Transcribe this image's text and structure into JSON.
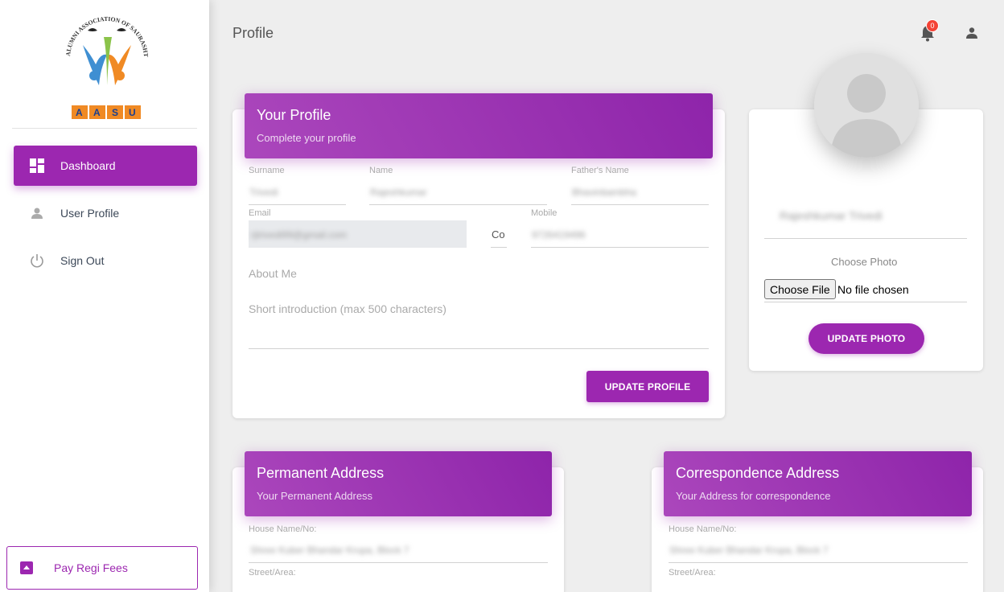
{
  "sidebar": {
    "logo": {
      "arc_text": "ALUMNI ASSOCIATION OF SAURASHTRA UNIVERSITY",
      "letters": [
        "A",
        "A",
        "S",
        "U"
      ]
    },
    "items": [
      {
        "label": "Dashboard",
        "icon": "dashboard-icon",
        "active": true
      },
      {
        "label": "User Profile",
        "icon": "person-icon",
        "active": false
      },
      {
        "label": "Sign Out",
        "icon": "power-icon",
        "active": false
      }
    ],
    "pay_button": {
      "label": "Pay Regi Fees",
      "icon": "unarchive-icon"
    }
  },
  "header": {
    "title": "Profile",
    "notification_count": "0"
  },
  "profile_card": {
    "title": "Your Profile",
    "subtitle": "Complete your profile",
    "fields": {
      "surname": {
        "label": "Surname",
        "value": "Trivedi"
      },
      "name": {
        "label": "Name",
        "value": "Rajeshkumar"
      },
      "father_name": {
        "label": "Father's Name",
        "value": "Bhavinbambha"
      },
      "email": {
        "label": "Email",
        "value": "rjtrivedi99@gmail.com"
      },
      "country_code": {
        "value": "Co"
      },
      "mobile": {
        "label": "Mobile",
        "value": "9726419496"
      },
      "about_me": {
        "label": "About Me",
        "placeholder": "Short introduction (max 500 characters)"
      }
    },
    "update_button": "UPDATE PROFILE"
  },
  "photo_card": {
    "display_name": "Rajeshkumar Trivedi",
    "choose_label": "Choose Photo",
    "file_button": "Choose File",
    "file_status": "No file chosen",
    "update_button": "UPDATE PHOTO"
  },
  "permanent_address": {
    "title": "Permanent Address",
    "subtitle": "Your Permanent Address",
    "house_label": "House Name/No:",
    "house_value": "Shree Kuber Bhandar Krupa, Block 7",
    "street_label": "Street/Area:"
  },
  "correspondence_address": {
    "title": "Correspondence Address",
    "subtitle": "Your Address for correspondence",
    "house_label": "House Name/No:",
    "house_value": "Shree Kuber Bhandar Krupa, Block 7",
    "street_label": "Street/Area:"
  },
  "colors": {
    "accent": "#9c27b0",
    "badge": "#f44336",
    "logo_orange": "#f08a24",
    "logo_blue": "#3f8fd2"
  }
}
